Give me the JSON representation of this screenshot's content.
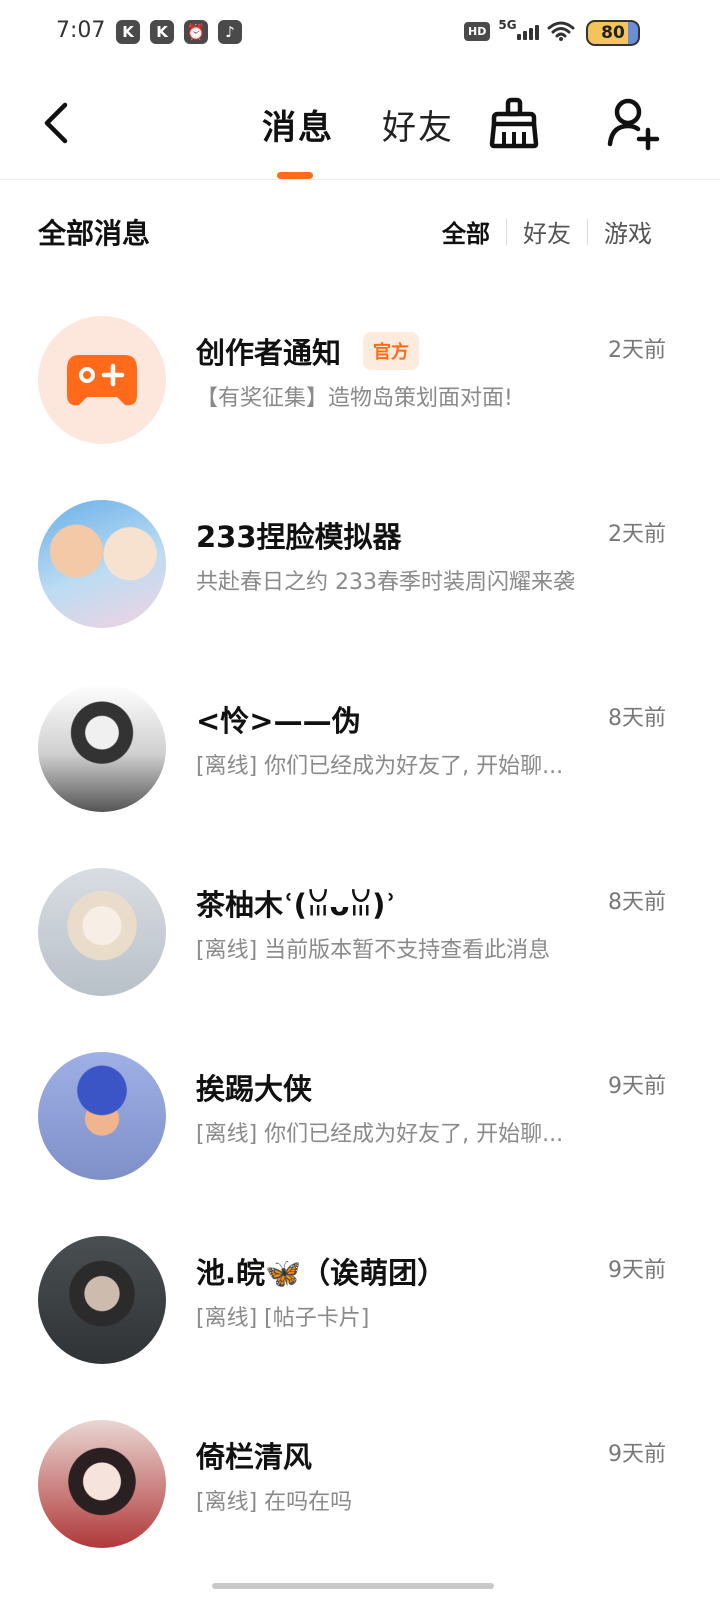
{
  "status_bar": {
    "time": "7:07",
    "app_icons": [
      "K",
      "K",
      "⏰",
      "♪"
    ],
    "hd": "HD",
    "network": "5G",
    "battery": "80"
  },
  "nav": {
    "tabs": [
      {
        "label": "消息",
        "active": true
      },
      {
        "label": "好友",
        "active": false
      }
    ],
    "icons": [
      "back-icon",
      "broom-icon",
      "add-user-icon"
    ],
    "accent_color": "#ff6b1a"
  },
  "filter_bar": {
    "title": "全部消息",
    "options": [
      {
        "label": "全部",
        "active": true
      },
      {
        "label": "好友",
        "active": false
      },
      {
        "label": "游戏",
        "active": false
      }
    ]
  },
  "conversations": [
    {
      "name": "创作者通知",
      "badge": "官方",
      "time": "2天前",
      "preview": "【有奖征集】造物岛策划面对面!"
    },
    {
      "name": "233捏脸模拟器",
      "time": "2天前",
      "preview": "共赴春日之约 233春季时装周闪耀来袭"
    },
    {
      "name": "<怜>——伪",
      "time": "8天前",
      "preview": "[离线] 你们已经成为好友了, 开始聊..."
    },
    {
      "name": "茶柚木ʿ(ꈍᴗꈍ)ʾ",
      "time": "8天前",
      "preview": "[离线] 当前版本暂不支持查看此消息"
    },
    {
      "name": "挨踢大侠",
      "time": "9天前",
      "preview": "[离线] 你们已经成为好友了, 开始聊..."
    },
    {
      "name": "池.皖🦋（诶萌团）",
      "time": "9天前",
      "preview": "[离线] [帖子卡片]"
    },
    {
      "name": "倚栏清风",
      "time": "9天前",
      "preview": "[离线] 在吗在吗"
    }
  ]
}
